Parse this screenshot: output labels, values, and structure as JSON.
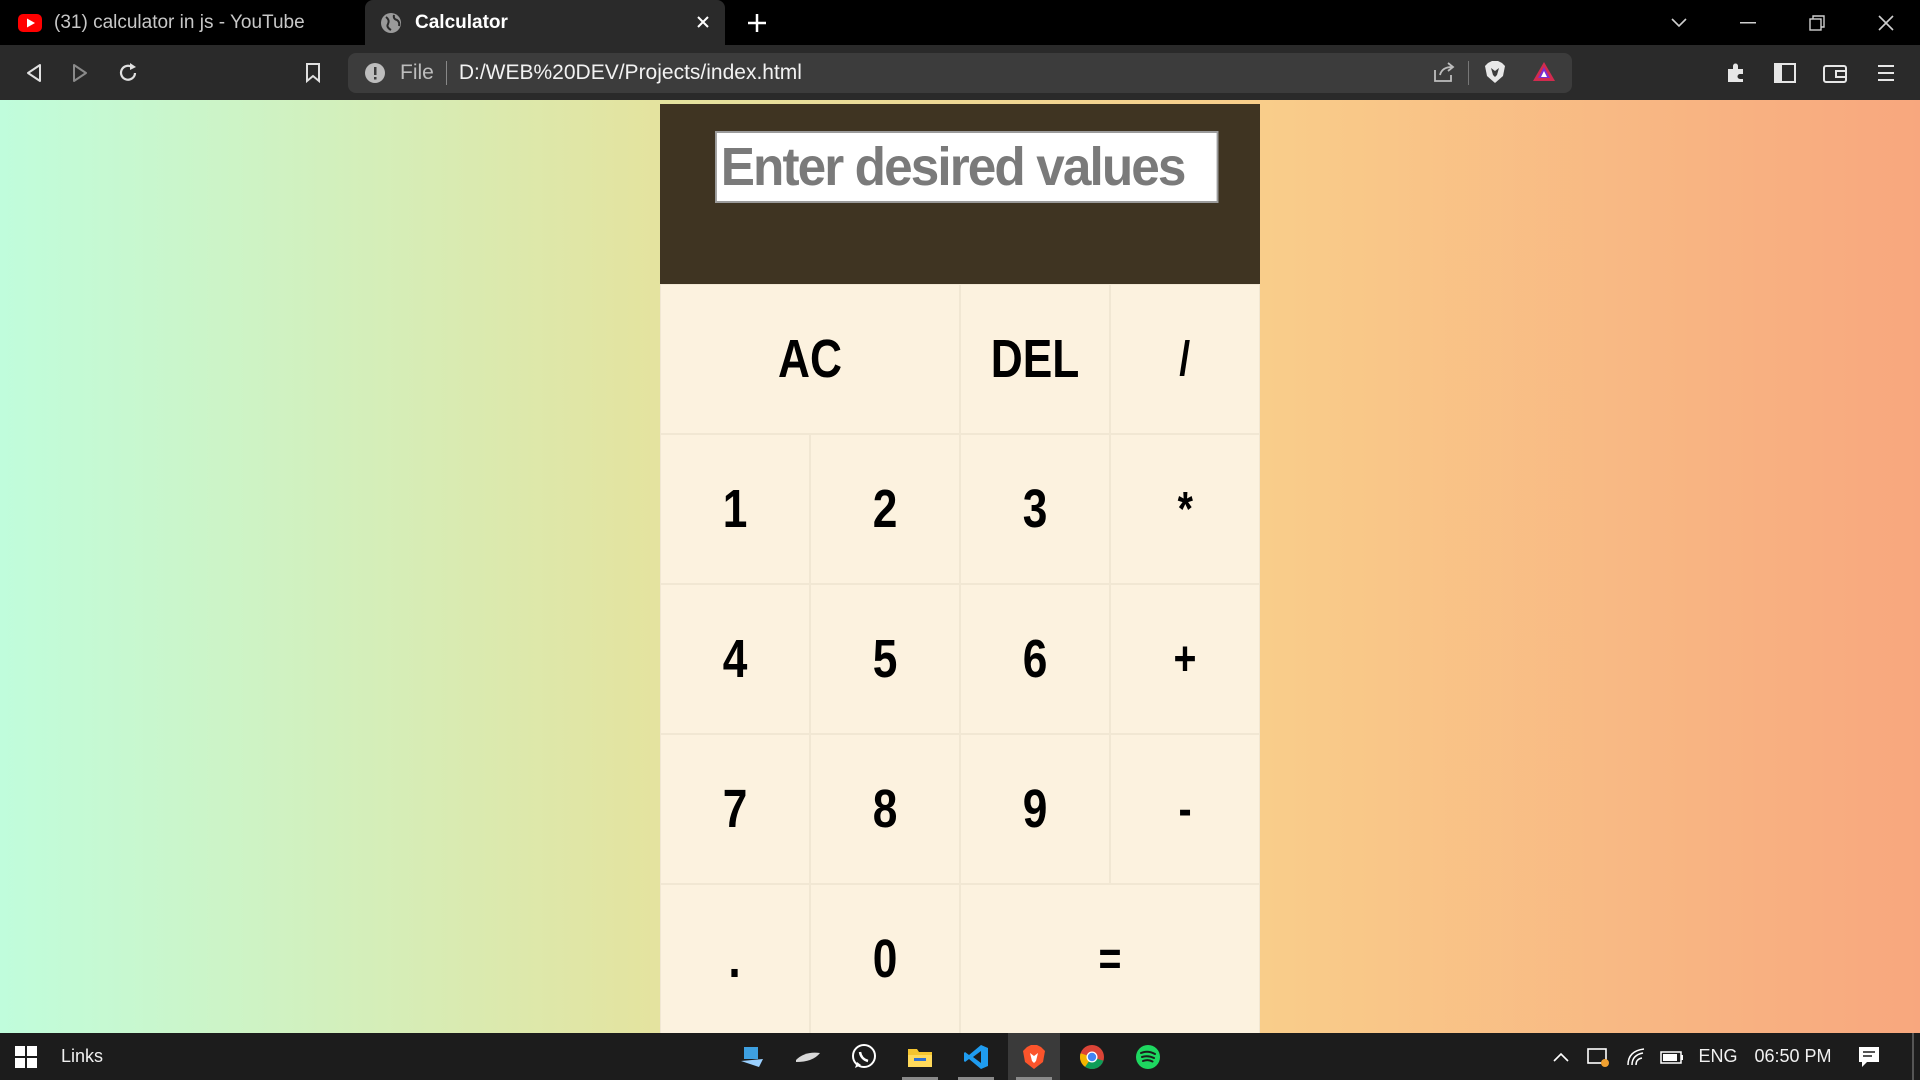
{
  "browser": {
    "tabs": [
      {
        "title": "(31) calculator in js - YouTube",
        "favicon": "youtube-icon",
        "active": false
      },
      {
        "title": "Calculator",
        "favicon": "globe-icon",
        "active": true
      }
    ],
    "address": {
      "scheme_label": "File",
      "url": "D:/WEB%20DEV/Projects/index.html"
    }
  },
  "calculator": {
    "display_placeholder": "Enter desired values",
    "keys": [
      {
        "label": "AC",
        "name": "key-all-clear",
        "span": 2
      },
      {
        "label": "DEL",
        "name": "key-delete",
        "span": 1
      },
      {
        "label": "/",
        "name": "key-divide",
        "span": 1
      },
      {
        "label": "1",
        "name": "key-1",
        "span": 1
      },
      {
        "label": "2",
        "name": "key-2",
        "span": 1
      },
      {
        "label": "3",
        "name": "key-3",
        "span": 1
      },
      {
        "label": "*",
        "name": "key-multiply",
        "span": 1
      },
      {
        "label": "4",
        "name": "key-4",
        "span": 1
      },
      {
        "label": "5",
        "name": "key-5",
        "span": 1
      },
      {
        "label": "6",
        "name": "key-6",
        "span": 1
      },
      {
        "label": "+",
        "name": "key-add",
        "span": 1
      },
      {
        "label": "7",
        "name": "key-7",
        "span": 1
      },
      {
        "label": "8",
        "name": "key-8",
        "span": 1
      },
      {
        "label": "9",
        "name": "key-9",
        "span": 1
      },
      {
        "label": "-",
        "name": "key-subtract",
        "span": 1
      },
      {
        "label": ".",
        "name": "key-decimal",
        "span": 1
      },
      {
        "label": "0",
        "name": "key-0",
        "span": 1
      },
      {
        "label": "=",
        "name": "key-equals",
        "span": 2
      }
    ]
  },
  "taskbar": {
    "links_label": "Links",
    "language": "ENG",
    "time": "06:50 PM",
    "apps": [
      "desktop-app-icon",
      "stylus-app-icon",
      "whatsapp-icon",
      "file-explorer-icon",
      "vscode-icon",
      "brave-icon",
      "chrome-icon",
      "spotify-icon"
    ]
  },
  "colors": {
    "display_panel": "#3f3422",
    "key_background": "#fcf2df",
    "gradient": [
      "#c0fddc",
      "#e4e39f",
      "#f9cd8a",
      "#f8a77e"
    ]
  }
}
